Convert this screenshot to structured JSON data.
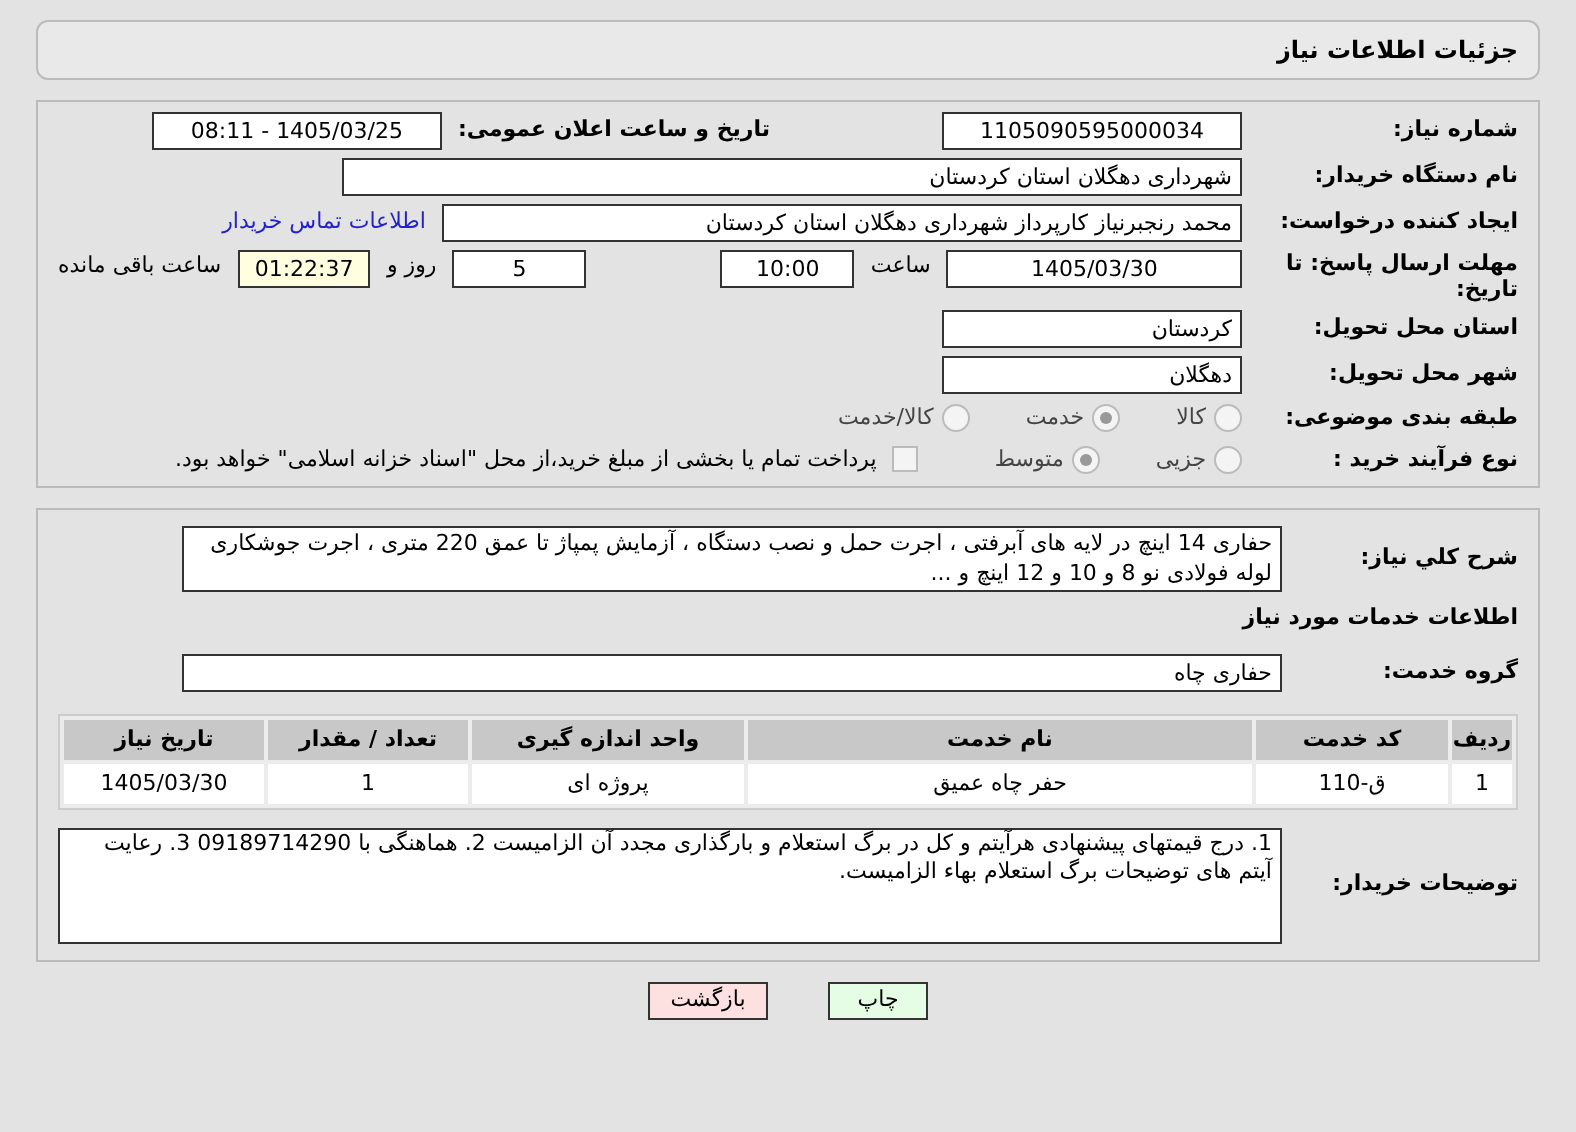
{
  "header": {
    "title": "جزئیات اطلاعات نیاز"
  },
  "need_number": {
    "label": "شماره نیاز:",
    "value": "1105090595000034"
  },
  "announce": {
    "label": "تاریخ و ساعت اعلان عمومی:",
    "value": "1405/03/25 - 08:11"
  },
  "buyer": {
    "label": "نام دستگاه خریدار:",
    "value": "شهرداری دهگلان استان کردستان"
  },
  "requester": {
    "label": "ایجاد کننده درخواست:",
    "value": "محمد رنجبرنیاز کارپرداز شهرداری دهگلان استان کردستان",
    "link": "اطلاعات تماس خریدار"
  },
  "deadline": {
    "label": "مهلت ارسال پاسخ: تا تاریخ:",
    "date": "1405/03/30",
    "time_label": "ساعت",
    "time": "10:00",
    "days": "5",
    "days_label": "روز و",
    "remaining": "01:22:37",
    "remaining_label": "ساعت باقی مانده"
  },
  "province": {
    "label": "استان محل تحویل:",
    "value": "کردستان"
  },
  "city": {
    "label": "شهر محل تحویل:",
    "value": "دهگلان"
  },
  "category": {
    "label": "طبقه بندی موضوعی:",
    "options": [
      {
        "label": "کالا",
        "selected": false
      },
      {
        "label": "خدمت",
        "selected": true
      },
      {
        "label": "کالا/خدمت",
        "selected": false
      }
    ]
  },
  "process": {
    "label": "نوع فرآیند خرید :",
    "options": [
      {
        "label": "جزیی",
        "selected": false
      },
      {
        "label": "متوسط",
        "selected": true
      }
    ],
    "payment": {
      "label": "پرداخت تمام یا بخشی از مبلغ خرید،از محل \"اسناد خزانه اسلامی\" خواهد بود.",
      "checked": false
    }
  },
  "description": {
    "label": "شرح کلي نياز:",
    "value": "حفاری 14 اینچ در لایه های آبرفتی ، اجرت حمل و نصب دستگاه ، آزمایش پمپاژ تا عمق 220 متری ، اجرت جوشکاری لوله فولادی نو 8 و 10 و 12 اینچ  و ..."
  },
  "services_title": "اطلاعات خدمات مورد نیاز",
  "service_group": {
    "label": "گروه خدمت:",
    "value": "حفاری چاه"
  },
  "table": {
    "columns": [
      "ردیف",
      "کد خدمت",
      "نام خدمت",
      "واحد اندازه گیری",
      "تعداد / مقدار",
      "تاریخ نیاز"
    ],
    "rows": [
      [
        "1",
        "ق-110",
        "حفر چاه عمیق",
        "پروژه ای",
        "1",
        "1405/03/30"
      ]
    ]
  },
  "notes": {
    "label": "توضیحات خریدار:",
    "value": "1. درج قیمتهای پیشنهادی هرآیتم و کل در برگ استعلام و بارگذاری مجدد آن الزامیست 2. هماهنگی با  09189714290 3. رعایت آیتم های توضیحات برگ استعلام بهاء الزامیست."
  },
  "buttons": [
    {
      "label": "چاپ",
      "kind": "print"
    },
    {
      "label": "بازگشت",
      "kind": "back"
    }
  ]
}
